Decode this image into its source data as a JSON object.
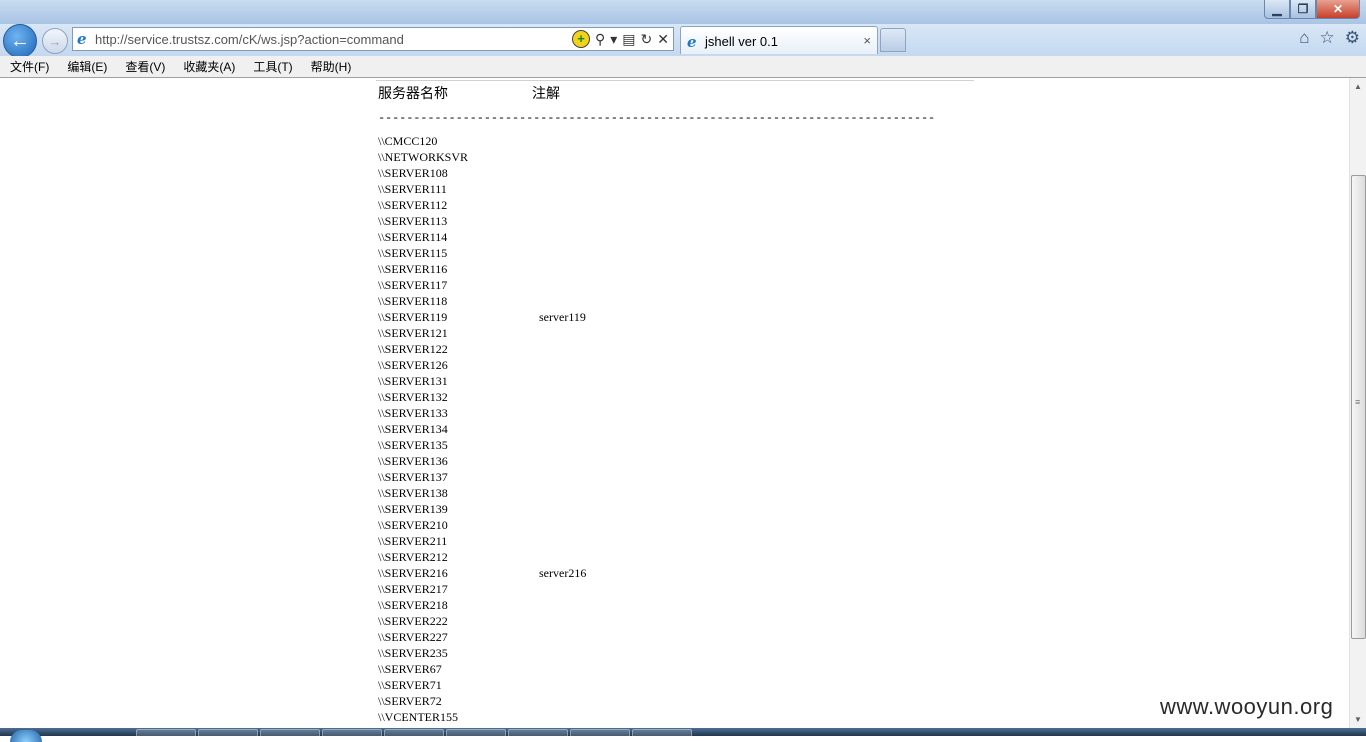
{
  "browser": {
    "address_url": "http://service.trustsz.com/cK/ws.jsp?action=command",
    "tab_title": "jshell ver 0.1",
    "tab_close": "×",
    "back_glyph": "←",
    "forward_glyph": "→"
  },
  "menu": {
    "items": [
      "文件(F)",
      "编辑(E)",
      "查看(V)",
      "收藏夹(A)",
      "工具(T)",
      "帮助(H)"
    ]
  },
  "content": {
    "header_server": "服务器名称",
    "header_note": "注解",
    "separator": "-------------------------------------------------------------------------------",
    "servers": [
      {
        "name": "\\\\CMCC120",
        "note": ""
      },
      {
        "name": "\\\\NETWORKSVR",
        "note": ""
      },
      {
        "name": "\\\\SERVER108",
        "note": ""
      },
      {
        "name": "\\\\SERVER111",
        "note": ""
      },
      {
        "name": "\\\\SERVER112",
        "note": ""
      },
      {
        "name": "\\\\SERVER113",
        "note": ""
      },
      {
        "name": "\\\\SERVER114",
        "note": ""
      },
      {
        "name": "\\\\SERVER115",
        "note": ""
      },
      {
        "name": "\\\\SERVER116",
        "note": ""
      },
      {
        "name": "\\\\SERVER117",
        "note": ""
      },
      {
        "name": "\\\\SERVER118",
        "note": ""
      },
      {
        "name": "\\\\SERVER119",
        "note": "server119"
      },
      {
        "name": "\\\\SERVER121",
        "note": ""
      },
      {
        "name": "\\\\SERVER122",
        "note": ""
      },
      {
        "name": "\\\\SERVER126",
        "note": ""
      },
      {
        "name": "\\\\SERVER131",
        "note": ""
      },
      {
        "name": "\\\\SERVER132",
        "note": ""
      },
      {
        "name": "\\\\SERVER133",
        "note": ""
      },
      {
        "name": "\\\\SERVER134",
        "note": ""
      },
      {
        "name": "\\\\SERVER135",
        "note": ""
      },
      {
        "name": "\\\\SERVER136",
        "note": ""
      },
      {
        "name": "\\\\SERVER137",
        "note": ""
      },
      {
        "name": "\\\\SERVER138",
        "note": ""
      },
      {
        "name": "\\\\SERVER139",
        "note": ""
      },
      {
        "name": "\\\\SERVER210",
        "note": ""
      },
      {
        "name": "\\\\SERVER211",
        "note": ""
      },
      {
        "name": "\\\\SERVER212",
        "note": ""
      },
      {
        "name": "\\\\SERVER216",
        "note": "server216"
      },
      {
        "name": "\\\\SERVER217",
        "note": ""
      },
      {
        "name": "\\\\SERVER218",
        "note": ""
      },
      {
        "name": "\\\\SERVER222",
        "note": ""
      },
      {
        "name": "\\\\SERVER227",
        "note": ""
      },
      {
        "name": "\\\\SERVER235",
        "note": ""
      },
      {
        "name": "\\\\SERVER67",
        "note": ""
      },
      {
        "name": "\\\\SERVER71",
        "note": ""
      },
      {
        "name": "\\\\SERVER72",
        "note": ""
      },
      {
        "name": "\\\\VCENTER155",
        "note": ""
      }
    ]
  },
  "watermark": "www.wooyun.org",
  "icons": {
    "window_minimize": "minimize-icon",
    "window_maximize": "maximize-icon",
    "window_close": "close-icon",
    "home": "home-icon",
    "favorites": "star-icon",
    "tools": "gear-icon"
  }
}
